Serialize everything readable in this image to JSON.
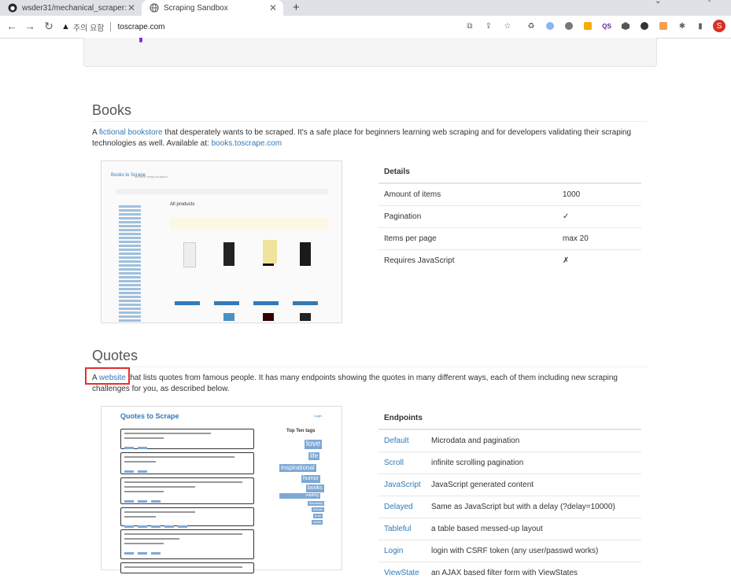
{
  "browser": {
    "tabs": [
      {
        "title": "wsder31/mechanical_scraper: Mc",
        "icon": "github-icon",
        "active": false
      },
      {
        "title": "Scraping Sandbox",
        "icon": "globe-icon",
        "active": true
      }
    ],
    "newtab_label": "+",
    "security_label": "주의 요함",
    "url": "toscrape.com",
    "avatar_initial": "S"
  },
  "books": {
    "title": "Books",
    "desc_prefix": "A ",
    "desc_link1": "fictional bookstore",
    "desc_middle": " that desperately wants to be scraped. It's a safe place for beginners learning web scraping and for developers validating their scraping technologies as well. Available at: ",
    "desc_link2": "books.toscrape.com",
    "preview": {
      "site_title": "Books to Scrape",
      "site_sub": "We love being scraped!",
      "heading": "All products"
    },
    "details": {
      "header": "Details",
      "rows": [
        {
          "label": "Amount of items",
          "value": "1000"
        },
        {
          "label": "Pagination",
          "value": "✓"
        },
        {
          "label": "Items per page",
          "value": "max 20"
        },
        {
          "label": "Requires JavaScript",
          "value": "✗"
        }
      ]
    }
  },
  "quotes": {
    "title": "Quotes",
    "desc_prefix": "A ",
    "desc_link": "website",
    "desc_rest": " that lists quotes from famous people. It has many endpoints showing the quotes in many different ways, each of them including new scraping challenges for you, as described below.",
    "preview": {
      "site_title": "Quotes to Scrape",
      "login": "Login",
      "tags_heading": "Top Ten tags",
      "tags": [
        "love",
        "life",
        "inspirational",
        "humor",
        "books",
        "reading",
        "friendship",
        "friends",
        "truth",
        "simile"
      ]
    },
    "endpoints": {
      "header": "Endpoints",
      "rows": [
        {
          "name": "Default",
          "desc": "Microdata and pagination"
        },
        {
          "name": "Scroll",
          "desc": "infinite scrolling pagination"
        },
        {
          "name": "JavaScript",
          "desc": "JavaScript generated content"
        },
        {
          "name": "Delayed",
          "desc": "Same as JavaScript but with a delay (?delay=10000)"
        },
        {
          "name": "Tableful",
          "desc": "a table based messed-up layout"
        },
        {
          "name": "Login",
          "desc": "login with CSRF token (any user/passwd works)"
        },
        {
          "name": "ViewState",
          "desc": "an AJAX based filter form with ViewStates"
        }
      ]
    }
  }
}
